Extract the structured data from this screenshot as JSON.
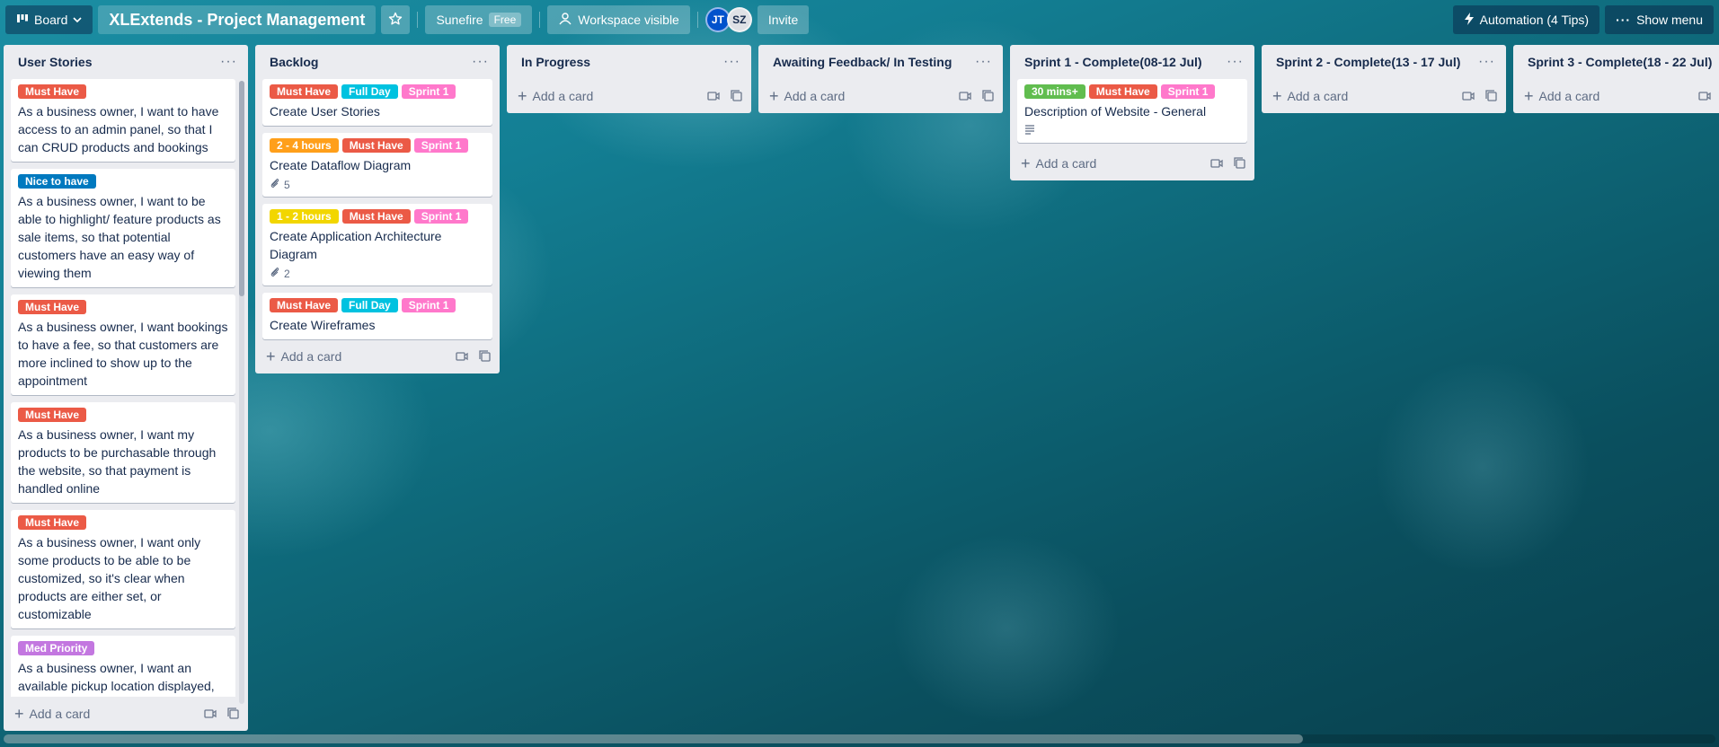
{
  "header": {
    "view_label": "Board",
    "board_title": "XLExtends - Project Management",
    "workspace": "Sunefire",
    "plan_badge": "Free",
    "visibility": "Workspace visible",
    "members": [
      "JT",
      "SZ"
    ],
    "invite": "Invite",
    "automation": "Automation (4 Tips)",
    "show_menu": "Show menu"
  },
  "colors": {
    "must_have": "#eb5a46",
    "full_day": "#00c2e0",
    "sprint_1": "#ff78cb",
    "two_four_hours": "#ff9f1a",
    "one_two_hours": "#f2d600",
    "thirty_mins": "#61bd4f",
    "nice_to_have": "#0079bf",
    "med_priority": "#c377e0"
  },
  "add_card": "Add a card",
  "lists": [
    {
      "title": "User Stories",
      "cards": [
        {
          "labels": [
            {
              "text": "Must Have",
              "color": "#eb5a46"
            }
          ],
          "title": "As a business owner, I want to have access to an admin panel, so that I can CRUD products and bookings"
        },
        {
          "labels": [
            {
              "text": "Nice to have",
              "color": "#0079bf"
            }
          ],
          "title": "As a business owner, I want to be able to highlight/ feature products as sale items, so that potential customers have an easy way of viewing them"
        },
        {
          "labels": [
            {
              "text": "Must Have",
              "color": "#eb5a46"
            }
          ],
          "title": "As a business owner, I want bookings to have a fee, so that customers are more inclined to show up to the appointment"
        },
        {
          "labels": [
            {
              "text": "Must Have",
              "color": "#eb5a46"
            }
          ],
          "title": "As a business owner, I want my products to be purchasable through the website, so that payment is handled online"
        },
        {
          "labels": [
            {
              "text": "Must Have",
              "color": "#eb5a46"
            }
          ],
          "title": "As a business owner, I want only some products to be able to be customized, so it's clear when products are either set, or customizable"
        },
        {
          "labels": [
            {
              "text": "Med Priority",
              "color": "#c377e0"
            }
          ],
          "title": "As a business owner, I want an available pickup location displayed,"
        }
      ]
    },
    {
      "title": "Backlog",
      "cards": [
        {
          "labels": [
            {
              "text": "Must Have",
              "color": "#eb5a46"
            },
            {
              "text": "Full Day",
              "color": "#00c2e0"
            },
            {
              "text": "Sprint 1",
              "color": "#ff78cb"
            }
          ],
          "title": "Create User Stories"
        },
        {
          "labels": [
            {
              "text": "2 - 4 hours",
              "color": "#ff9f1a"
            },
            {
              "text": "Must Have",
              "color": "#eb5a46"
            },
            {
              "text": "Sprint 1",
              "color": "#ff78cb"
            }
          ],
          "title": "Create Dataflow Diagram",
          "attachments": "5"
        },
        {
          "labels": [
            {
              "text": "1 - 2 hours",
              "color": "#f2d600"
            },
            {
              "text": "Must Have",
              "color": "#eb5a46"
            },
            {
              "text": "Sprint 1",
              "color": "#ff78cb"
            }
          ],
          "title": "Create Application Architecture Diagram",
          "attachments": "2"
        },
        {
          "labels": [
            {
              "text": "Must Have",
              "color": "#eb5a46"
            },
            {
              "text": "Full Day",
              "color": "#00c2e0"
            },
            {
              "text": "Sprint 1",
              "color": "#ff78cb"
            }
          ],
          "title": "Create Wireframes"
        }
      ]
    },
    {
      "title": "In Progress",
      "cards": []
    },
    {
      "title": "Awaiting Feedback/ In Testing",
      "cards": []
    },
    {
      "title": "Sprint 1 - Complete(08-12 Jul)",
      "cards": [
        {
          "labels": [
            {
              "text": "30 mins+",
              "color": "#61bd4f"
            },
            {
              "text": "Must Have",
              "color": "#eb5a46"
            },
            {
              "text": "Sprint 1",
              "color": "#ff78cb"
            }
          ],
          "title": "Description of Website - General",
          "has_description": true
        }
      ]
    },
    {
      "title": "Sprint 2 - Complete(13 - 17 Jul)",
      "cards": []
    },
    {
      "title": "Sprint 3 - Complete(18 - 22 Jul)",
      "cards": []
    }
  ]
}
